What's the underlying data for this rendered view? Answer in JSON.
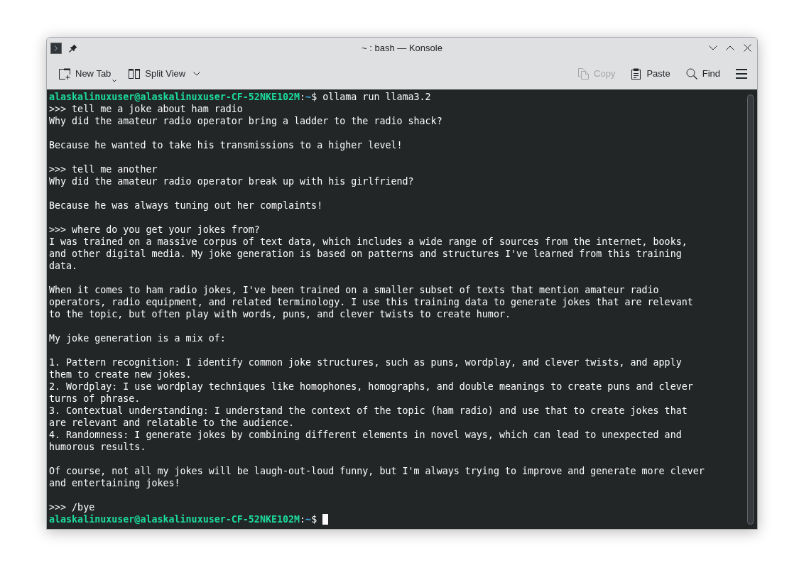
{
  "window": {
    "title": "~ : bash — Konsole"
  },
  "toolbar": {
    "left": [
      {
        "kind": "new-tab",
        "label": "New Tab",
        "disabled": false
      },
      {
        "kind": "split-view",
        "label": "Split View",
        "disabled": false
      }
    ],
    "right": [
      {
        "kind": "copy",
        "label": "Copy",
        "disabled": true
      },
      {
        "kind": "paste",
        "label": "Paste",
        "disabled": false
      },
      {
        "kind": "find",
        "label": "Find",
        "disabled": false
      }
    ]
  },
  "terminal": {
    "blocks": [
      {
        "kind": "prompt",
        "user_host": "alaskalinuxuser@alaskalinuxuser-CF-52NKE102M",
        "separator": ":",
        "path": "~",
        "symbol": "$",
        "command": "ollama run llama3.2",
        "cursor": false
      },
      {
        "kind": "input",
        "text": ">>> tell me a joke about ham radio"
      },
      {
        "kind": "output",
        "lines": [
          "Why did the amateur radio operator bring a ladder to the radio shack?"
        ]
      },
      {
        "kind": "blank"
      },
      {
        "kind": "output",
        "lines": [
          "Because he wanted to take his transmissions to a higher level!"
        ]
      },
      {
        "kind": "blank"
      },
      {
        "kind": "input",
        "text": ">>> tell me another"
      },
      {
        "kind": "output",
        "lines": [
          "Why did the amateur radio operator break up with his girlfriend?"
        ]
      },
      {
        "kind": "blank"
      },
      {
        "kind": "output",
        "lines": [
          "Because he was always tuning out her complaints!"
        ]
      },
      {
        "kind": "blank"
      },
      {
        "kind": "input",
        "text": ">>> where do you get your jokes from?"
      },
      {
        "kind": "output",
        "lines": [
          "I was trained on a massive corpus of text data, which includes a wide range of sources from the internet, books,",
          "and other digital media. My joke generation is based on patterns and structures I've learned from this training",
          "data."
        ]
      },
      {
        "kind": "blank"
      },
      {
        "kind": "output",
        "lines": [
          "When it comes to ham radio jokes, I've been trained on a smaller subset of texts that mention amateur radio",
          "operators, radio equipment, and related terminology. I use this training data to generate jokes that are relevant",
          "to the topic, but often play with words, puns, and clever twists to create humor."
        ]
      },
      {
        "kind": "blank"
      },
      {
        "kind": "output",
        "lines": [
          "My joke generation is a mix of:"
        ]
      },
      {
        "kind": "blank"
      },
      {
        "kind": "output",
        "lines": [
          "1. Pattern recognition: I identify common joke structures, such as puns, wordplay, and clever twists, and apply",
          "them to create new jokes."
        ]
      },
      {
        "kind": "output",
        "lines": [
          "2. Wordplay: I use wordplay techniques like homophones, homographs, and double meanings to create puns and clever",
          "turns of phrase."
        ]
      },
      {
        "kind": "output",
        "lines": [
          "3. Contextual understanding: I understand the context of the topic (ham radio) and use that to create jokes that",
          "are relevant and relatable to the audience."
        ]
      },
      {
        "kind": "output",
        "lines": [
          "4. Randomness: I generate jokes by combining different elements in novel ways, which can lead to unexpected and",
          "humorous results."
        ]
      },
      {
        "kind": "blank"
      },
      {
        "kind": "output",
        "lines": [
          "Of course, not all my jokes will be laugh-out-loud funny, but I'm always trying to improve and generate more clever",
          "and entertaining jokes!"
        ]
      },
      {
        "kind": "blank"
      },
      {
        "kind": "input",
        "text": ">>> /bye"
      },
      {
        "kind": "prompt",
        "user_host": "alaskalinuxuser@alaskalinuxuser-CF-52NKE102M",
        "separator": ":",
        "path": "~",
        "symbol": "$",
        "cursor": true
      }
    ]
  }
}
